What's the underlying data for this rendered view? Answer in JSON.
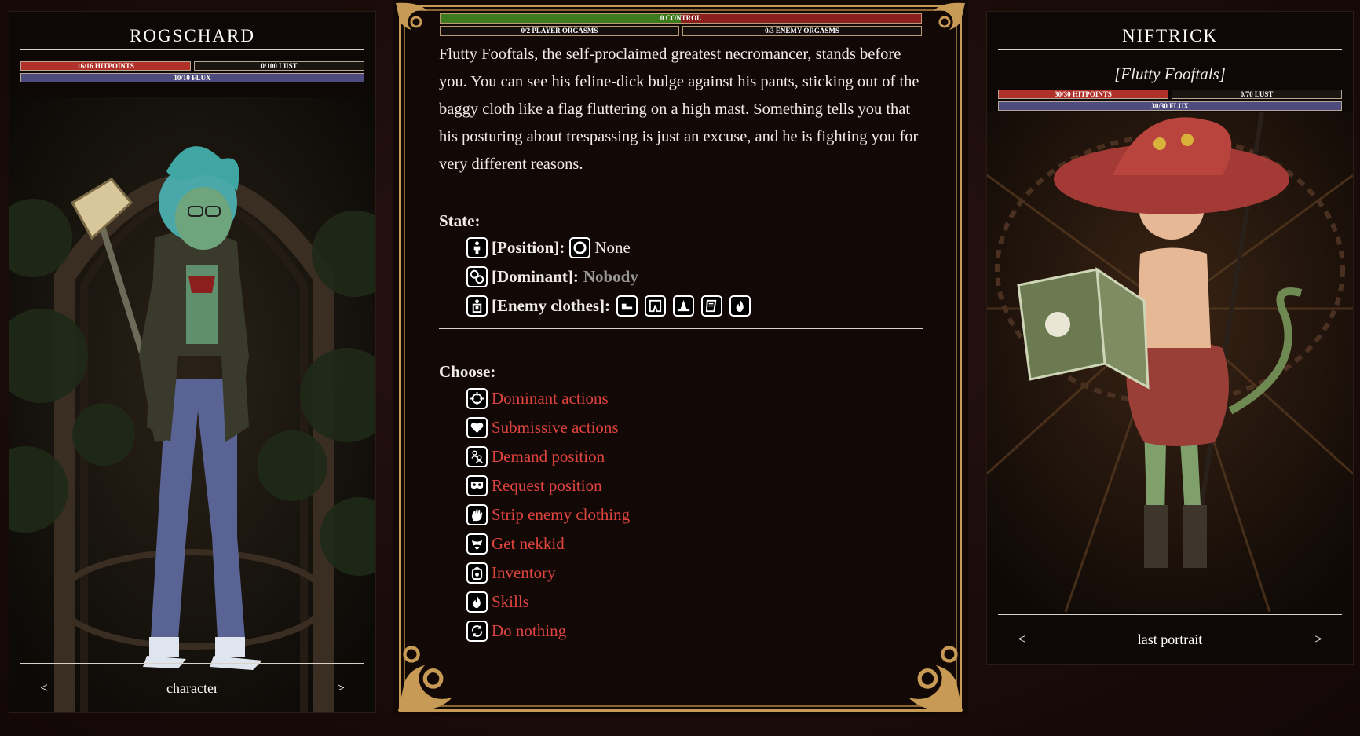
{
  "left_panel": {
    "title": "ROGSCHARD",
    "hitpoints": "16/16 HITPOINTS",
    "lust": "0/100 LUST",
    "flux": "10/10 FLUX",
    "nav": {
      "prev": "<",
      "label": "character",
      "next": ">"
    }
  },
  "right_panel": {
    "title": "NIFTRICK",
    "subtitle": "[Flutty Fooftals]",
    "hitpoints": "30/30 HITPOINTS",
    "lust": "0/70 LUST",
    "flux": "30/30 FLUX",
    "nav": {
      "prev": "<",
      "label": "last portrait",
      "next": ">"
    }
  },
  "center": {
    "control": "0 CONTROL",
    "control_split": 0.5,
    "player_orgasms": "0/2 PLAYER ORGASMS",
    "enemy_orgasms": "0/3 ENEMY ORGASMS",
    "story": "Flutty Fooftals, the self-proclaimed greatest necromancer, stands before you. You can see his feline-dick bulge against his pants, sticking out of the baggy cloth like a flag fluttering on a high mast. Something tells you that his posturing about trespassing is just an excuse, and he is fighting you for very different reasons.",
    "state_heading": "State:",
    "state": {
      "position_label": "[Position]:",
      "position_value": "None",
      "dominant_label": "[Dominant]:",
      "dominant_value": "Nobody",
      "clothes_label": "[Enemy clothes]:"
    },
    "choose_heading": "Choose:",
    "actions": [
      {
        "label": "Dominant actions",
        "icon": "crosshair-icon"
      },
      {
        "label": "Submissive actions",
        "icon": "heart-icon"
      },
      {
        "label": "Demand position",
        "icon": "people-icon"
      },
      {
        "label": "Request position",
        "icon": "mask-icon"
      },
      {
        "label": "Strip enemy clothing",
        "icon": "hand-icon"
      },
      {
        "label": "Get nekkid",
        "icon": "underwear-icon"
      },
      {
        "label": "Inventory",
        "icon": "backpack-icon"
      },
      {
        "label": "Skills",
        "icon": "flame-icon"
      },
      {
        "label": "Do nothing",
        "icon": "cycle-icon"
      }
    ]
  },
  "colors": {
    "accent_red": "#e0443e",
    "hp": "#b0302a",
    "flux": "#4e4b7e",
    "frame_gold": "#c79a55"
  }
}
